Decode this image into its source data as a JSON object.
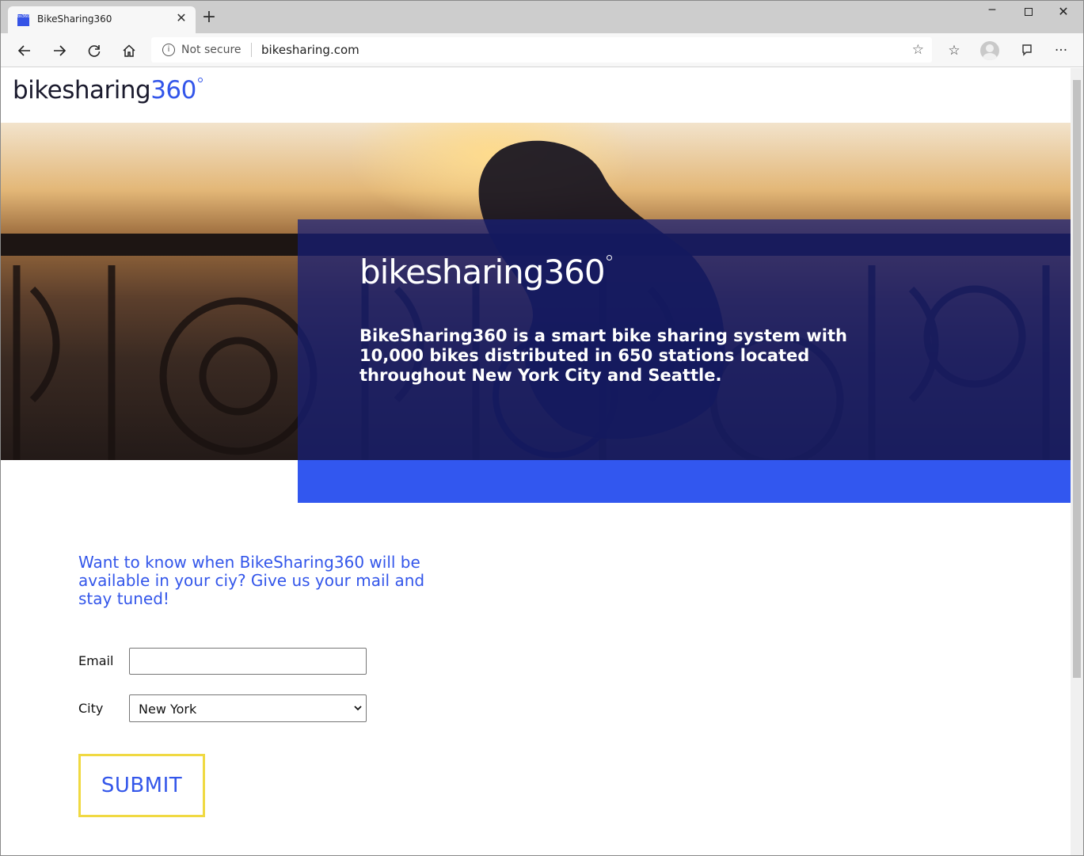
{
  "browser": {
    "tab_title": "BikeSharing360",
    "favicon_text": "bs360",
    "tab_close": "✕",
    "new_tab": "+",
    "security_label": "Not secure",
    "url": "bikesharing.com",
    "info_icon_glyph": "i",
    "favorite_star": "☆",
    "collections": "☆",
    "more": "···"
  },
  "site": {
    "logo_text": "bikesharing",
    "logo_number": "360",
    "hero_logo_text": "bikesharing360",
    "hero_description": "BikeSharing360 is a smart bike sharing system with 10,000 bikes distributed in 650 stations located throughout New York City and Seattle.",
    "accent_color": "#3356ea",
    "band_color": "#3257ef",
    "submit_border_color": "#f0d942"
  },
  "form": {
    "cta": "Want to know when BikeSharing360 will be available in your ciy? Give us your mail and stay tuned!",
    "email_label": "Email",
    "email_value": "",
    "city_label": "City",
    "city_selected": "New York",
    "submit_label": "SUBMIT"
  }
}
